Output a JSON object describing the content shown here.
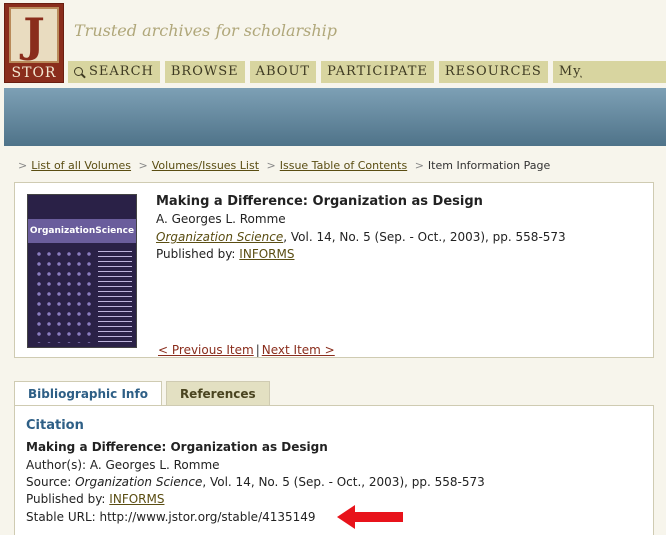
{
  "header": {
    "logo_letter": "J",
    "logo_word": "STOR",
    "tagline": "Trusted archives for scholarship",
    "nav": [
      {
        "label": "SEARCH",
        "icon": "magnifier-icon"
      },
      {
        "label": "BROWSE"
      },
      {
        "label": "ABOUT"
      },
      {
        "label": "PARTICIPATE"
      },
      {
        "label": "RESOURCES"
      },
      {
        "label": "MyJSTOR"
      }
    ]
  },
  "breadcrumb": {
    "links": [
      "List of all Volumes",
      "Volumes/Issues List",
      "Issue Table of Contents"
    ],
    "current": "Item Information Page"
  },
  "item": {
    "cover_title": "OrganizationScience",
    "title": "Making a Difference: Organization as Design",
    "author": "A. Georges L. Romme",
    "journal": "Organization Science",
    "source_rest": ", Vol. 14, No. 5 (Sep. - Oct., 2003), pp. 558-573",
    "published_label": "Published by: ",
    "publisher": "INFORMS",
    "prev_label": "< Previous Item",
    "next_label": "Next Item >",
    "separator": "|"
  },
  "tabs": [
    {
      "label": "Bibliographic Info",
      "active": true
    },
    {
      "label": "References",
      "active": false
    }
  ],
  "citation": {
    "heading": "Citation",
    "title": "Making a Difference: Organization as Design",
    "author_label": "Author(s): ",
    "author": "A. Georges L. Romme",
    "source_label": "Source: ",
    "journal": "Organization Science",
    "source_rest": ", Vol. 14, No. 5 (Sep. - Oct., 2003), pp. 558-573",
    "published_label": "Published by: ",
    "publisher": "INFORMS",
    "stable_label": "Stable URL: ",
    "stable_url": "http://www.jstor.org/stable/4135149"
  },
  "colors": {
    "accent_red": "#e8131b",
    "nav_bg": "#d8d5a0",
    "link_blue": "#2e5f86"
  }
}
